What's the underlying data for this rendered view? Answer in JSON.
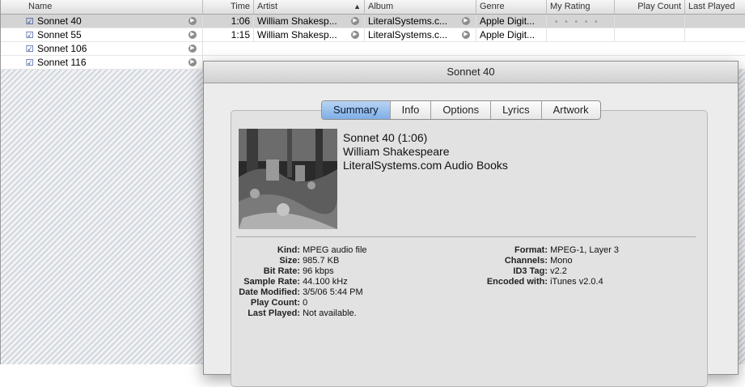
{
  "columns": {
    "name": "Name",
    "time": "Time",
    "artist": "Artist",
    "album": "Album",
    "genre": "Genre",
    "rating": "My Rating",
    "play_count": "Play Count",
    "last_played": "Last Played"
  },
  "tracks": [
    {
      "name": "Sonnet 40",
      "time": "1:06",
      "artist": "William Shakesp...",
      "album": "LiteralSystems.c...",
      "genre": "Apple Digit...",
      "checked": true,
      "selected": true
    },
    {
      "name": "Sonnet 55",
      "time": "1:15",
      "artist": "William Shakesp...",
      "album": "LiteralSystems.c...",
      "genre": "Apple Digit...",
      "checked": true,
      "selected": false
    },
    {
      "name": "Sonnet 106",
      "time": "",
      "artist": "",
      "album": "",
      "genre": "",
      "checked": true,
      "selected": false
    },
    {
      "name": "Sonnet 116",
      "time": "",
      "artist": "",
      "album": "",
      "genre": "",
      "checked": true,
      "selected": false
    }
  ],
  "rating_dots": "• • • • •",
  "info_window": {
    "title": "Sonnet 40",
    "tabs": [
      "Summary",
      "Info",
      "Options",
      "Lyrics",
      "Artwork"
    ],
    "active_tab": "Summary",
    "summary": {
      "title_line": "Sonnet 40 (1:06)",
      "artist": "William Shakespeare",
      "album": "LiteralSystems.com Audio Books"
    },
    "details_left": [
      {
        "label": "Kind:",
        "value": "MPEG audio file"
      },
      {
        "label": "Size:",
        "value": "985.7 KB"
      },
      {
        "label": "Bit Rate:",
        "value": "96 kbps"
      },
      {
        "label": "Sample Rate:",
        "value": "44.100 kHz"
      },
      {
        "label": "Date Modified:",
        "value": "3/5/06 5:44 PM"
      },
      {
        "label": "Play Count:",
        "value": "0"
      },
      {
        "label": "Last Played:",
        "value": "Not available."
      }
    ],
    "details_right": [
      {
        "label": "Format:",
        "value": "MPEG-1, Layer 3"
      },
      {
        "label": "Channels:",
        "value": "Mono"
      },
      {
        "label": "ID3 Tag:",
        "value": "v2.2"
      },
      {
        "label": "Encoded with:",
        "value": "iTunes v2.0.4"
      }
    ]
  },
  "colors": {
    "selected_row": "#d4d4d4",
    "active_tab": "#7eaee6",
    "stripe": "#788caf"
  }
}
